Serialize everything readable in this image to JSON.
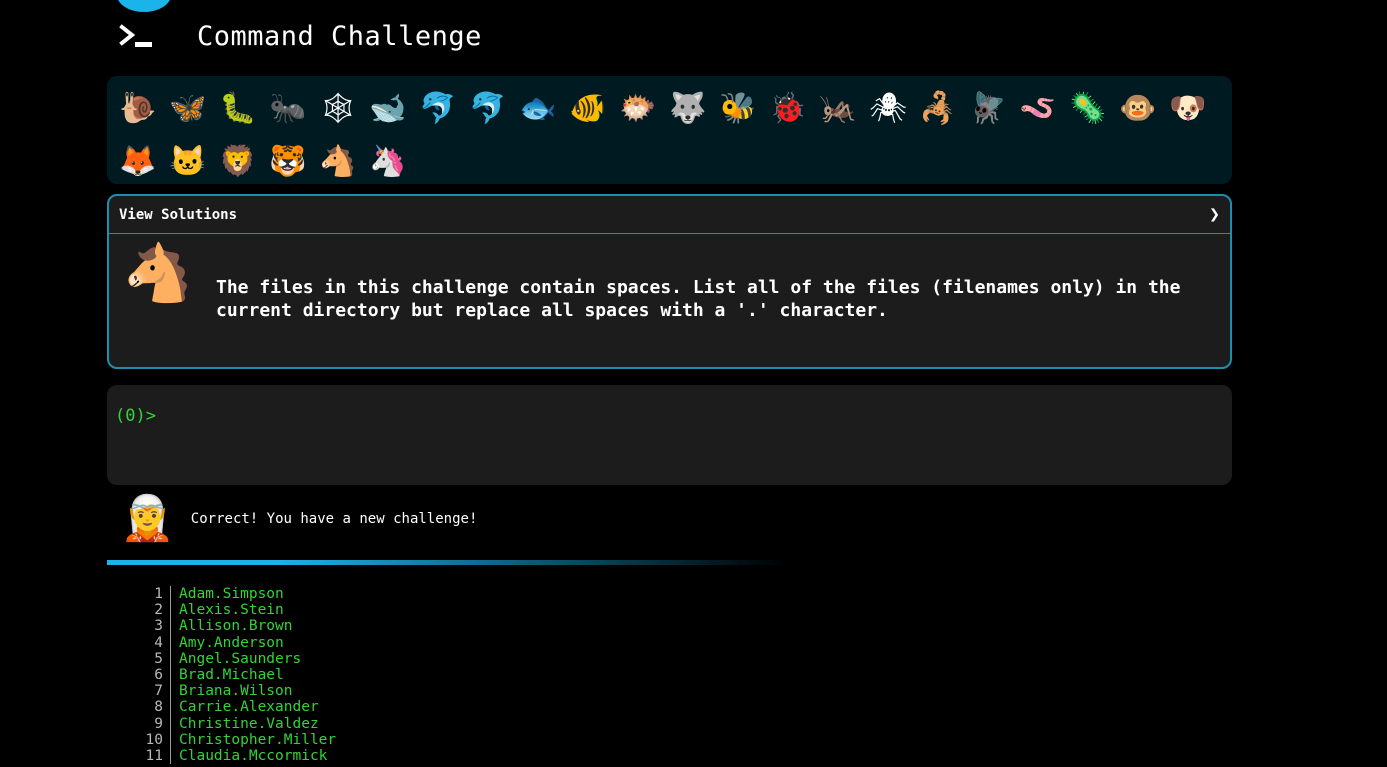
{
  "header": {
    "title": "Command Challenge",
    "icon": "terminal-icon",
    "accent_color": "#1ab3ea"
  },
  "emoji_bar": {
    "items": [
      {
        "name": "snail",
        "glyph": "🐌"
      },
      {
        "name": "butterfly",
        "glyph": "🦋"
      },
      {
        "name": "bug",
        "glyph": "🐛"
      },
      {
        "name": "ant",
        "glyph": "🐜"
      },
      {
        "name": "spider-web",
        "glyph": "🕸"
      },
      {
        "name": "whale",
        "glyph": "🐋"
      },
      {
        "name": "dolphin",
        "glyph": "🐬"
      },
      {
        "name": "shark",
        "glyph": "🐬"
      },
      {
        "name": "fish",
        "glyph": "🐟"
      },
      {
        "name": "tropical-fish",
        "glyph": "🐠"
      },
      {
        "name": "blowfish",
        "glyph": "🐡"
      },
      {
        "name": "wolf",
        "glyph": "🐺"
      },
      {
        "name": "bee",
        "glyph": "🐝"
      },
      {
        "name": "ladybug",
        "glyph": "🐞"
      },
      {
        "name": "cricket",
        "glyph": "🦗"
      },
      {
        "name": "spider",
        "glyph": "🕷"
      },
      {
        "name": "scorpion",
        "glyph": "🦂"
      },
      {
        "name": "fly",
        "glyph": "🪰"
      },
      {
        "name": "worm",
        "glyph": "🪱"
      },
      {
        "name": "microbe",
        "glyph": "🦠"
      },
      {
        "name": "monkey",
        "glyph": "🐵"
      },
      {
        "name": "dog",
        "glyph": "🐶"
      },
      {
        "name": "fox",
        "glyph": "🦊"
      },
      {
        "name": "cat",
        "glyph": "🐱"
      },
      {
        "name": "lion",
        "glyph": "🦁"
      },
      {
        "name": "tiger",
        "glyph": "🐯"
      },
      {
        "name": "horse",
        "glyph": "🐴"
      },
      {
        "name": "unicorn",
        "glyph": "🦄"
      }
    ]
  },
  "challenge": {
    "solutions_label": "View Solutions",
    "chevron": "❯",
    "avatar": "🐴",
    "text": "The files in this challenge contain spaces. List all of the files (filenames only) in the current directory but replace all spaces with a '.' character.",
    "border_color": "#1d8fad"
  },
  "terminal": {
    "prompt": "(0)>",
    "input_value": "",
    "prompt_color": "#35d335"
  },
  "feedback": {
    "avatar": "🧝",
    "message": "Correct! You have a new challenge!"
  },
  "output": {
    "lines": [
      {
        "no": "1",
        "text": "Adam.Simpson"
      },
      {
        "no": "2",
        "text": "Alexis.Stein"
      },
      {
        "no": "3",
        "text": "Allison.Brown"
      },
      {
        "no": "4",
        "text": "Amy.Anderson"
      },
      {
        "no": "5",
        "text": "Angel.Saunders"
      },
      {
        "no": "6",
        "text": "Brad.Michael"
      },
      {
        "no": "7",
        "text": "Briana.Wilson"
      },
      {
        "no": "8",
        "text": "Carrie.Alexander"
      },
      {
        "no": "9",
        "text": "Christine.Valdez"
      },
      {
        "no": "10",
        "text": "Christopher.Miller"
      },
      {
        "no": "11",
        "text": "Claudia.Mccormick"
      }
    ]
  }
}
